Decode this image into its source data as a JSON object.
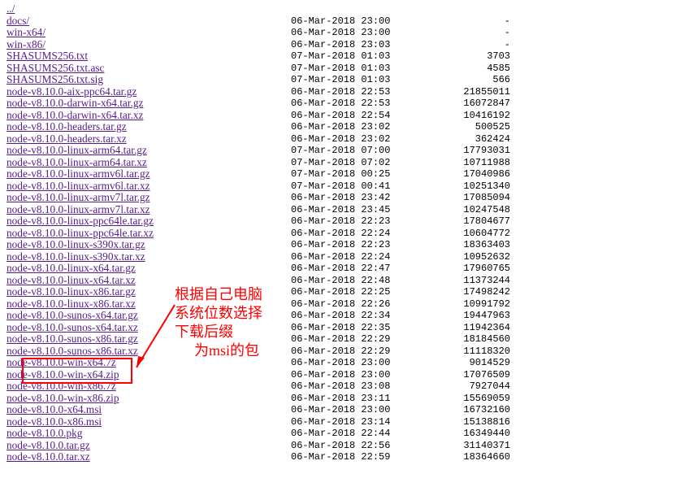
{
  "files": [
    {
      "name": "../",
      "date": "",
      "size": ""
    },
    {
      "name": "docs/",
      "date": "06-Mar-2018 23:00",
      "size": "-"
    },
    {
      "name": "win-x64/",
      "date": "06-Mar-2018 23:00",
      "size": "-"
    },
    {
      "name": "win-x86/",
      "date": "06-Mar-2018 23:03",
      "size": "-"
    },
    {
      "name": "SHASUMS256.txt",
      "date": "07-Mar-2018 01:03",
      "size": "3703"
    },
    {
      "name": "SHASUMS256.txt.asc",
      "date": "07-Mar-2018 01:03",
      "size": "4585"
    },
    {
      "name": "SHASUMS256.txt.sig",
      "date": "07-Mar-2018 01:03",
      "size": "566"
    },
    {
      "name": "node-v8.10.0-aix-ppc64.tar.gz",
      "date": "06-Mar-2018 22:53",
      "size": "21855011"
    },
    {
      "name": "node-v8.10.0-darwin-x64.tar.gz",
      "date": "06-Mar-2018 22:53",
      "size": "16072847"
    },
    {
      "name": "node-v8.10.0-darwin-x64.tar.xz",
      "date": "06-Mar-2018 22:54",
      "size": "10416192"
    },
    {
      "name": "node-v8.10.0-headers.tar.gz",
      "date": "06-Mar-2018 23:02",
      "size": "500525"
    },
    {
      "name": "node-v8.10.0-headers.tar.xz",
      "date": "06-Mar-2018 23:02",
      "size": "362424"
    },
    {
      "name": "node-v8.10.0-linux-arm64.tar.gz",
      "date": "07-Mar-2018 07:00",
      "size": "17793031"
    },
    {
      "name": "node-v8.10.0-linux-arm64.tar.xz",
      "date": "07-Mar-2018 07:02",
      "size": "10711988"
    },
    {
      "name": "node-v8.10.0-linux-armv6l.tar.gz",
      "date": "07-Mar-2018 00:25",
      "size": "17040986"
    },
    {
      "name": "node-v8.10.0-linux-armv6l.tar.xz",
      "date": "07-Mar-2018 00:41",
      "size": "10251340"
    },
    {
      "name": "node-v8.10.0-linux-armv7l.tar.gz",
      "date": "06-Mar-2018 23:42",
      "size": "17085094"
    },
    {
      "name": "node-v8.10.0-linux-armv7l.tar.xz",
      "date": "06-Mar-2018 23:45",
      "size": "10247548"
    },
    {
      "name": "node-v8.10.0-linux-ppc64le.tar.gz",
      "date": "06-Mar-2018 22:23",
      "size": "17804677"
    },
    {
      "name": "node-v8.10.0-linux-ppc64le.tar.xz",
      "date": "06-Mar-2018 22:24",
      "size": "10604772"
    },
    {
      "name": "node-v8.10.0-linux-s390x.tar.gz",
      "date": "06-Mar-2018 22:23",
      "size": "18363403"
    },
    {
      "name": "node-v8.10.0-linux-s390x.tar.xz",
      "date": "06-Mar-2018 22:24",
      "size": "10952632"
    },
    {
      "name": "node-v8.10.0-linux-x64.tar.gz",
      "date": "06-Mar-2018 22:47",
      "size": "17960765"
    },
    {
      "name": "node-v8.10.0-linux-x64.tar.xz",
      "date": "06-Mar-2018 22:48",
      "size": "11373244"
    },
    {
      "name": "node-v8.10.0-linux-x86.tar.gz",
      "date": "06-Mar-2018 22:25",
      "size": "17498242"
    },
    {
      "name": "node-v8.10.0-linux-x86.tar.xz",
      "date": "06-Mar-2018 22:26",
      "size": "10991792"
    },
    {
      "name": "node-v8.10.0-sunos-x64.tar.gz",
      "date": "06-Mar-2018 22:34",
      "size": "19447963"
    },
    {
      "name": "node-v8.10.0-sunos-x64.tar.xz",
      "date": "06-Mar-2018 22:35",
      "size": "11942364"
    },
    {
      "name": "node-v8.10.0-sunos-x86.tar.gz",
      "date": "06-Mar-2018 22:29",
      "size": "18184560"
    },
    {
      "name": "node-v8.10.0-sunos-x86.tar.xz",
      "date": "06-Mar-2018 22:29",
      "size": "11118320"
    },
    {
      "name": "node-v8.10.0-win-x64.7z",
      "date": "06-Mar-2018 23:00",
      "size": "9014529"
    },
    {
      "name": "node-v8.10.0-win-x64.zip",
      "date": "06-Mar-2018 23:00",
      "size": "17076509"
    },
    {
      "name": "node-v8.10.0-win-x86.7z",
      "date": "06-Mar-2018 23:08",
      "size": "7927044"
    },
    {
      "name": "node-v8.10.0-win-x86.zip",
      "date": "06-Mar-2018 23:11",
      "size": "15569059"
    },
    {
      "name": "node-v8.10.0-x64.msi",
      "date": "06-Mar-2018 23:00",
      "size": "16732160"
    },
    {
      "name": "node-v8.10.0-x86.msi",
      "date": "06-Mar-2018 23:14",
      "size": "15138816"
    },
    {
      "name": "node-v8.10.0.pkg",
      "date": "06-Mar-2018 22:44",
      "size": "16349440"
    },
    {
      "name": "node-v8.10.0.tar.gz",
      "date": "06-Mar-2018 22:56",
      "size": "31140371"
    },
    {
      "name": "node-v8.10.0.tar.xz",
      "date": "06-Mar-2018 22:59",
      "size": "18364660"
    }
  ],
  "annotation": {
    "line1": "根据自己电脑",
    "line2": "系统位数选择",
    "line3": "下载后缀",
    "line4": "为msi的包"
  }
}
